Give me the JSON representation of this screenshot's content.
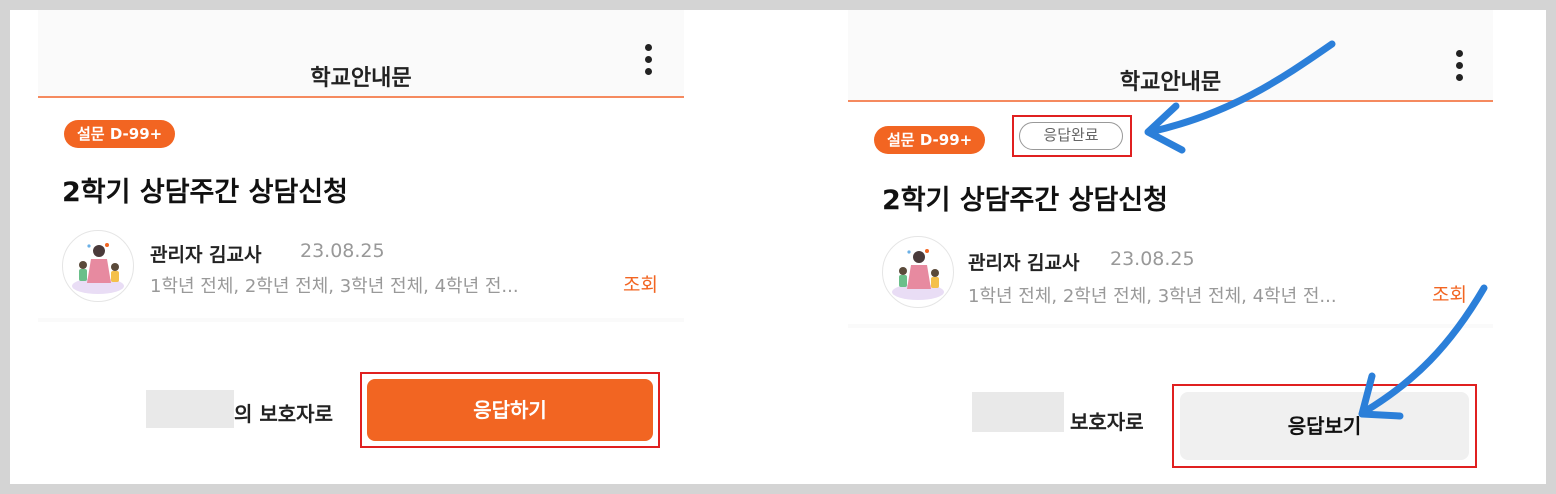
{
  "colors": {
    "accent": "#f26522",
    "highlight": "#e02020",
    "arrow": "#2b7fd9"
  },
  "left": {
    "header": {
      "title": "학교안내문",
      "more_icon": "more-vertical-icon"
    },
    "card": {
      "dday_badge": "설문 D-99+",
      "title": "2학기 상담주간 상담신청",
      "author": "관리자 김교사",
      "date": "23.08.25",
      "target": "1학년 전체, 2학년 전체, 3학년 전체, 4학년 전...",
      "view_label": "조회"
    },
    "bottom": {
      "guardian_label": "의 보호자로",
      "action_button": "응답하기"
    }
  },
  "right": {
    "header": {
      "title": "학교안내문",
      "more_icon": "more-vertical-icon"
    },
    "card": {
      "dday_badge": "설문 D-99+",
      "status_badge": "응답완료",
      "title": "2학기 상담주간 상담신청",
      "author": "관리자 김교사",
      "date": "23.08.25",
      "target": "1학년 전체, 2학년 전체, 3학년 전체, 4학년 전...",
      "view_label": "조회"
    },
    "bottom": {
      "guardian_label": "보호자로",
      "action_button": "응답보기"
    }
  }
}
